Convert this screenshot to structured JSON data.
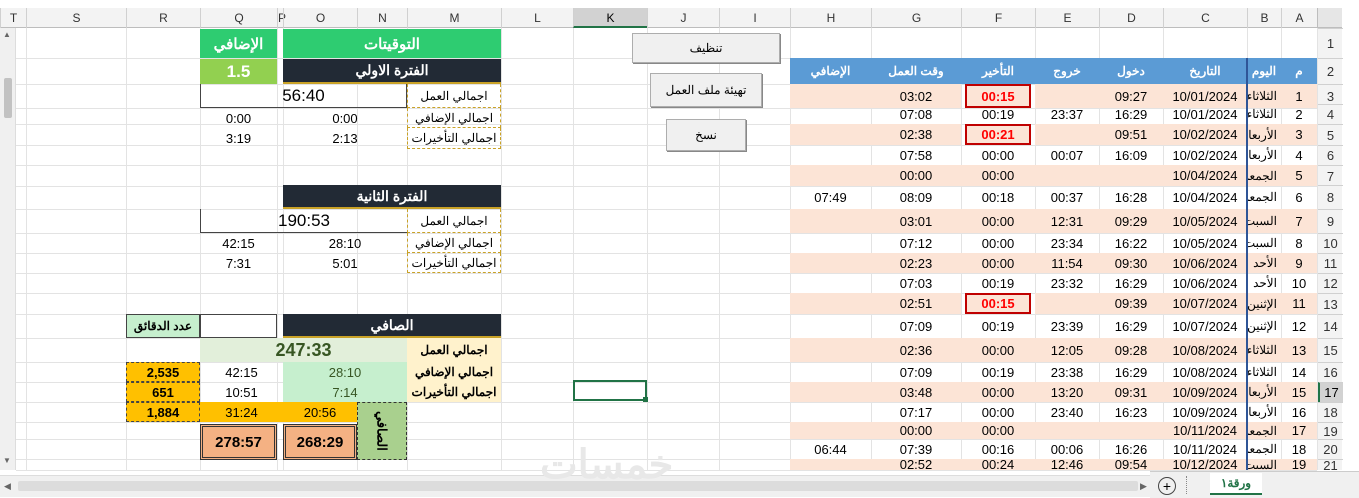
{
  "columns": [
    "T",
    "S",
    "R",
    "Q",
    "P",
    "O",
    "N",
    "M",
    "L",
    "K",
    "J",
    "I",
    "H",
    "G",
    "F",
    "E",
    "D",
    "C",
    "B",
    "A"
  ],
  "selected_column": "K",
  "rows": [
    "1",
    "2",
    "3",
    "4",
    "5",
    "6",
    "7",
    "8",
    "9",
    "10",
    "11",
    "12",
    "13",
    "14",
    "15",
    "16",
    "17",
    "18",
    "19",
    "20",
    "21"
  ],
  "selected_row": "17",
  "buttons": {
    "clean": "تنظيف",
    "prepare": "تهيئة ملف العمل",
    "copy": "نسخ"
  },
  "table": {
    "headers": [
      "م",
      "اليوم",
      "التاريخ",
      "دخول",
      "خروج",
      "التأخير",
      "وقت العمل",
      "الإضافي"
    ],
    "rows": [
      [
        "1",
        "الثلاثاء",
        "10/01/2024",
        "09:27",
        "",
        "00:15",
        "03:02",
        ""
      ],
      [
        "2",
        "الثلاثاء",
        "10/01/2024",
        "16:29",
        "23:37",
        "00:19",
        "07:08",
        ""
      ],
      [
        "3",
        "الأربعاء",
        "10/02/2024",
        "09:51",
        "",
        "00:21",
        "02:38",
        ""
      ],
      [
        "4",
        "الأربعاء",
        "10/02/2024",
        "16:09",
        "00:07",
        "00:00",
        "07:58",
        ""
      ],
      [
        "5",
        "الجمعة",
        "10/04/2024",
        "",
        "",
        "00:00",
        "00:00",
        ""
      ],
      [
        "6",
        "الجمعة",
        "10/04/2024",
        "16:28",
        "00:37",
        "00:18",
        "08:09",
        "07:49"
      ],
      [
        "7",
        "السبت",
        "10/05/2024",
        "09:29",
        "12:31",
        "00:00",
        "03:01",
        ""
      ],
      [
        "8",
        "السبت",
        "10/05/2024",
        "16:22",
        "23:34",
        "00:00",
        "07:12",
        ""
      ],
      [
        "9",
        "الأحد",
        "10/06/2024",
        "09:30",
        "11:54",
        "00:00",
        "02:23",
        ""
      ],
      [
        "10",
        "الأحد",
        "10/06/2024",
        "16:29",
        "23:32",
        "00:19",
        "07:03",
        ""
      ],
      [
        "11",
        "الإثنين",
        "10/07/2024",
        "09:39",
        "",
        "00:15",
        "02:51",
        ""
      ],
      [
        "12",
        "الإثنين",
        "10/07/2024",
        "16:29",
        "23:39",
        "00:19",
        "07:09",
        ""
      ],
      [
        "13",
        "الثلاثاء",
        "10/08/2024",
        "09:28",
        "12:05",
        "00:00",
        "02:36",
        ""
      ],
      [
        "14",
        "الثلاثاء",
        "10/08/2024",
        "16:29",
        "23:38",
        "00:19",
        "07:09",
        ""
      ],
      [
        "15",
        "الأربعاء",
        "10/09/2024",
        "09:31",
        "13:20",
        "00:00",
        "03:48",
        ""
      ],
      [
        "16",
        "الأربعاء",
        "10/09/2024",
        "16:23",
        "23:40",
        "00:00",
        "07:17",
        ""
      ],
      [
        "17",
        "الجمعة",
        "10/11/2024",
        "",
        "",
        "00:00",
        "00:00",
        ""
      ],
      [
        "18",
        "الجمعة",
        "10/11/2024",
        "16:26",
        "00:06",
        "00:16",
        "07:39",
        "06:44"
      ],
      [
        "19",
        "السبت",
        "10/12/2024",
        "09:54",
        "12:46",
        "00:24",
        "02:52",
        ""
      ]
    ]
  },
  "summary": {
    "timings_title": "التوقيتات",
    "extra_title": "الإضافي",
    "extra_rate": "1.5",
    "period1": {
      "title": "الفترة الاولي",
      "work_label": "اجمالي العمل",
      "work": "56:40",
      "extra_label": "اجمالي الإضافي",
      "extra_o": "0:00",
      "extra_q": "0:00",
      "late_label": "اجمالي التأخيرات",
      "late_o": "2:13",
      "late_q": "3:19"
    },
    "period2": {
      "title": "الفترة الثانية",
      "work_label": "اجمالي العمل",
      "work": "190:53",
      "extra_label": "اجمالي الإضافي",
      "extra_o": "28:10",
      "extra_q": "42:15",
      "late_label": "اجمالي التأخيرات",
      "late_o": "5:01",
      "late_q": "7:31"
    },
    "net": {
      "title": "الصافي",
      "minutes_label": "عدد الدقائق",
      "work_label": "اجمالي العمل",
      "work": "247:33",
      "extra_label": "اجمالي الإضافي",
      "extra_o": "28:10",
      "extra_q": "42:15",
      "extra_min": "2,535",
      "late_label": "اجمالي التأخيرات",
      "late_o": "7:14",
      "late_q": "10:51",
      "late_min": "651",
      "o_diff": "20:56",
      "q_diff": "31:24",
      "min_diff": "1,884",
      "net_label": "الصافي",
      "net_o": "268:29",
      "net_q": "278:57"
    }
  },
  "sheet_tab": "ورقة١",
  "watermark": "خمسات"
}
